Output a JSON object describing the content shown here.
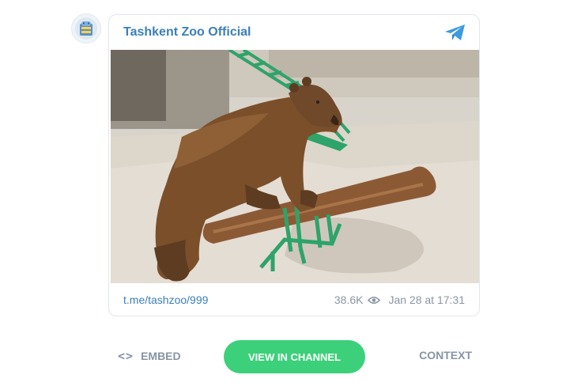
{
  "channel": {
    "name": "Tashkent Zoo Official",
    "avatar_icon": "zoo-logo",
    "platform_icon": "telegram-icon"
  },
  "post": {
    "image_alt": "Brown bear standing on a log in a zoo enclosure",
    "link": "t.me/tashzoo/999",
    "views": "38.6K",
    "date": "Jan 28 at 17:31"
  },
  "actions": {
    "embed_label": "EMBED",
    "view_label": "VIEW IN CHANNEL",
    "context_label": "CONTEXT"
  },
  "colors": {
    "accent_blue": "#3a7fb8",
    "telegram_blue": "#3d9ae0",
    "button_green": "#3cd07a",
    "muted_text": "#8a96a3"
  }
}
